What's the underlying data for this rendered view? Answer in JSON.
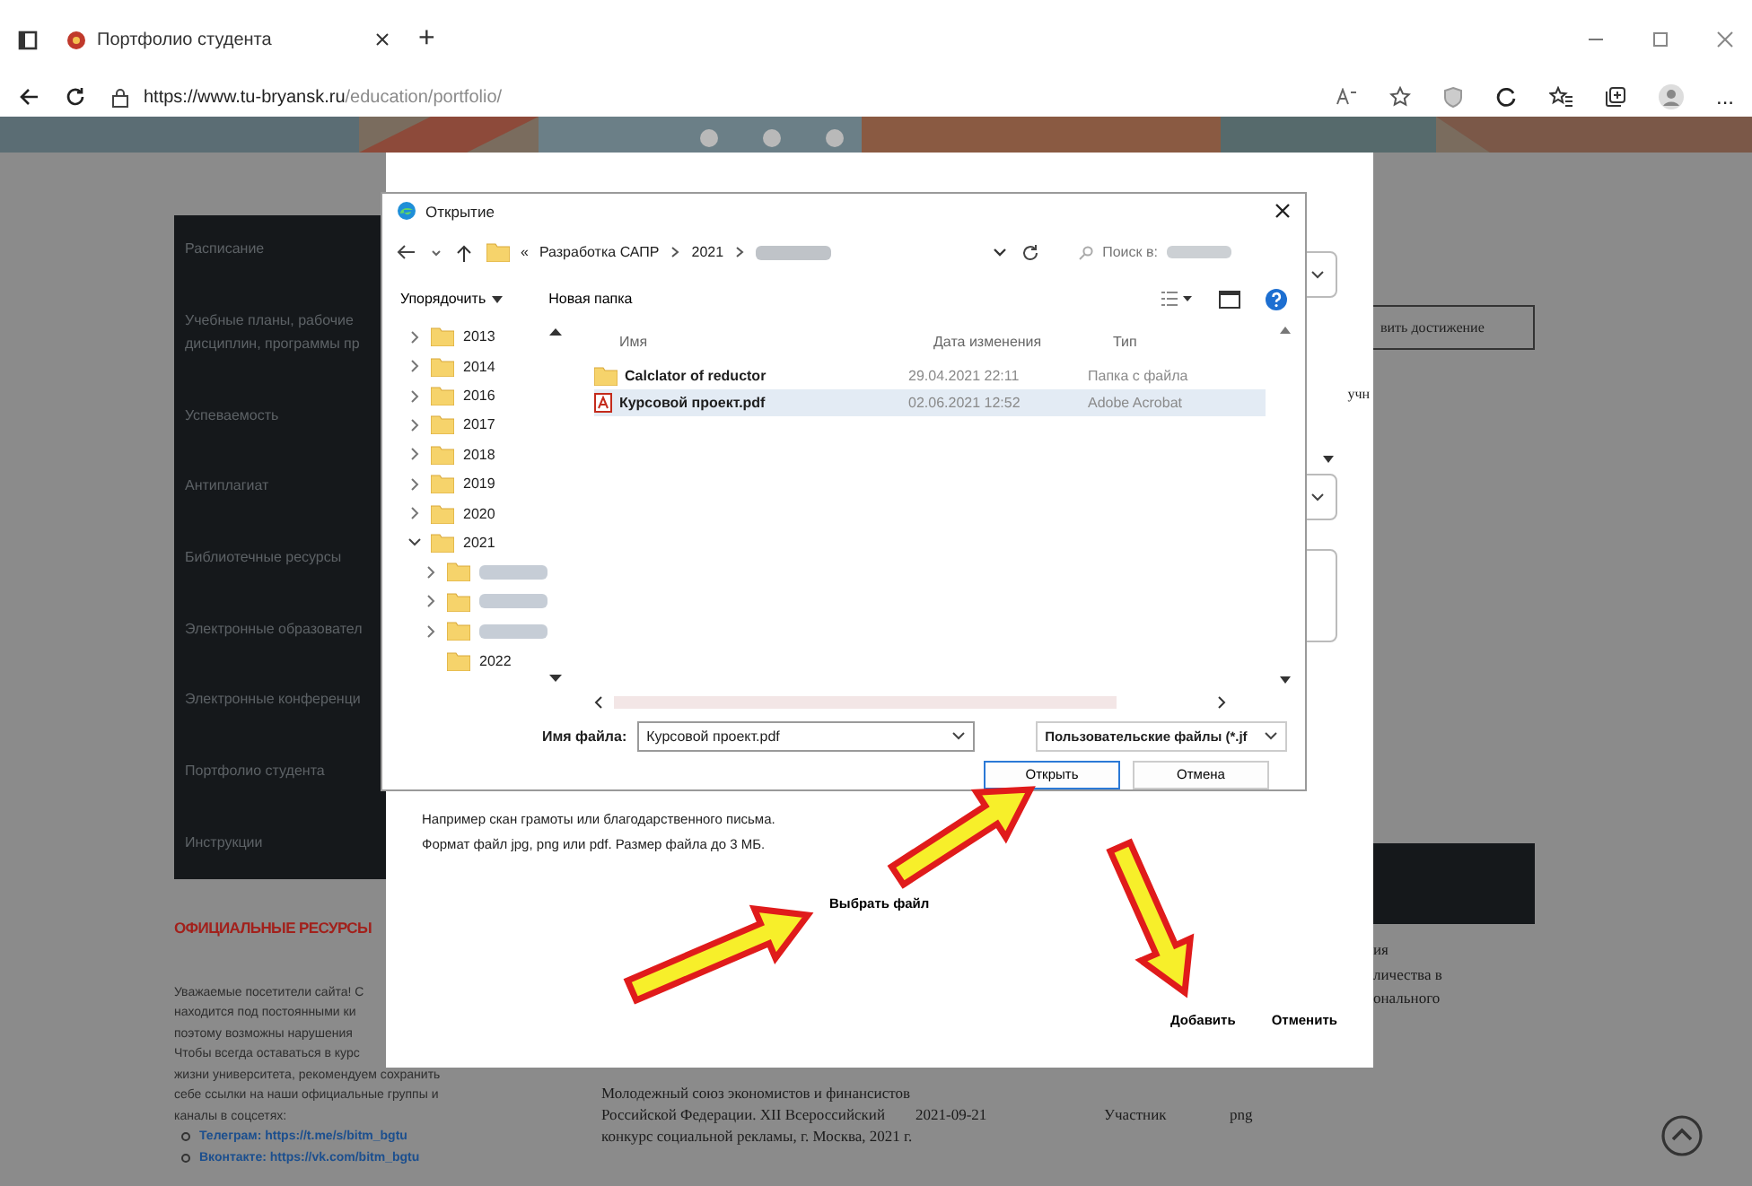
{
  "browser": {
    "tab": {
      "title": "Портфолио студента",
      "selected": true
    },
    "new_tab": "+",
    "url": {
      "host": "https://www.tu-bryansk.ru",
      "path": "/education/portfolio/"
    },
    "more": "..."
  },
  "sidebar": {
    "items": [
      {
        "label": "Расписание"
      },
      {
        "label": "Учебные планы, рабочие дисциплин, программы пр"
      },
      {
        "label": "Успеваемость"
      },
      {
        "label": "Антиплагиат"
      },
      {
        "label": "Библиотечные ресурсы"
      },
      {
        "label": "Электронные образовател"
      },
      {
        "label": "Электронные конференци"
      },
      {
        "label": "Портфолио студента"
      },
      {
        "label": "Инструкции"
      }
    ]
  },
  "resources": {
    "title": "ОФИЦИАЛЬНЫЕ РЕСУРСЫ",
    "lines": [
      "Уважаемые посетители сайта! С",
      "находится под постоянными ки",
      "поэтому возможны нарушения",
      "Чтобы всегда оставаться в курс",
      "жизни университета, рекомендуем сохранить",
      "себе ссылки на наши официальные группы и",
      "каналы в соцсетях:"
    ],
    "links": [
      {
        "label": "Телеграм: https://t.me/s/bitm_bgtu"
      },
      {
        "label": "Вконтакте: https://vk.com/bitm_bgtu"
      }
    ]
  },
  "page_right": {
    "button": "вить достижение",
    "notes": [
      "ия",
      "личества в",
      "онального"
    ]
  },
  "table_row": {
    "event": "Молодежный союз экономистов и финансистов Российской Федерации. XII Всероссийский конкурс социальной рекламы, г. Москва, 2021 г.",
    "date": "2021-09-21",
    "role": "Участник",
    "type": "png"
  },
  "modal": {
    "label_fragment": "учн",
    "hint_lines": [
      "Например скан грамоты или благодарственного письма.",
      "Формат файл jpg, png или pdf. Размер файла до 3 МБ."
    ],
    "choose_file": "Выбрать файл",
    "buttons": [
      "Добавить",
      "Отменить"
    ]
  },
  "dialog": {
    "title": "Открытие",
    "breadcrumb_overflow": "«",
    "breadcrumb": [
      "Разработка САПР",
      "2021"
    ],
    "search_hint": "Поиск в:",
    "toolbar": [
      "Упорядочить",
      "Новая папка"
    ],
    "tree": [
      {
        "kind": "folder",
        "label": "2013",
        "expanded": false
      },
      {
        "kind": "folder",
        "label": "2014",
        "expanded": false
      },
      {
        "kind": "folder",
        "label": "2016",
        "expanded": false
      },
      {
        "kind": "folder",
        "label": "2017",
        "expanded": false
      },
      {
        "kind": "folder",
        "label": "2018",
        "expanded": false
      },
      {
        "kind": "folder",
        "label": "2019",
        "expanded": false
      },
      {
        "kind": "folder",
        "label": "2020",
        "expanded": false
      },
      {
        "kind": "folder",
        "label": "2021",
        "expanded": true,
        "children": [
          {
            "kind": "blurred",
            "expanded": false
          },
          {
            "kind": "blurred",
            "expanded": false
          },
          {
            "kind": "blurred",
            "expanded": false
          },
          {
            "kind": "leaf",
            "label": "2022"
          }
        ]
      }
    ],
    "columns": [
      "Имя",
      "Дата изменения",
      "Тип"
    ],
    "files": [
      {
        "kind": "folder",
        "name": "Calclator of reductor",
        "date": "29.04.2021 22:11",
        "type": "Папка с файла",
        "selected": false
      },
      {
        "kind": "pdf",
        "name": "Курсовой проект.pdf",
        "date": "02.06.2021 12:52",
        "type": "Adobe Acrobat",
        "selected": true
      }
    ],
    "filename": {
      "label": "Имя файла:",
      "value": "Курсовой проект.pdf"
    },
    "filter": "Пользовательские файлы (*.jf",
    "buttons": [
      {
        "label": "Открыть",
        "default": true
      },
      {
        "label": "Отмена",
        "default": false
      }
    ]
  }
}
